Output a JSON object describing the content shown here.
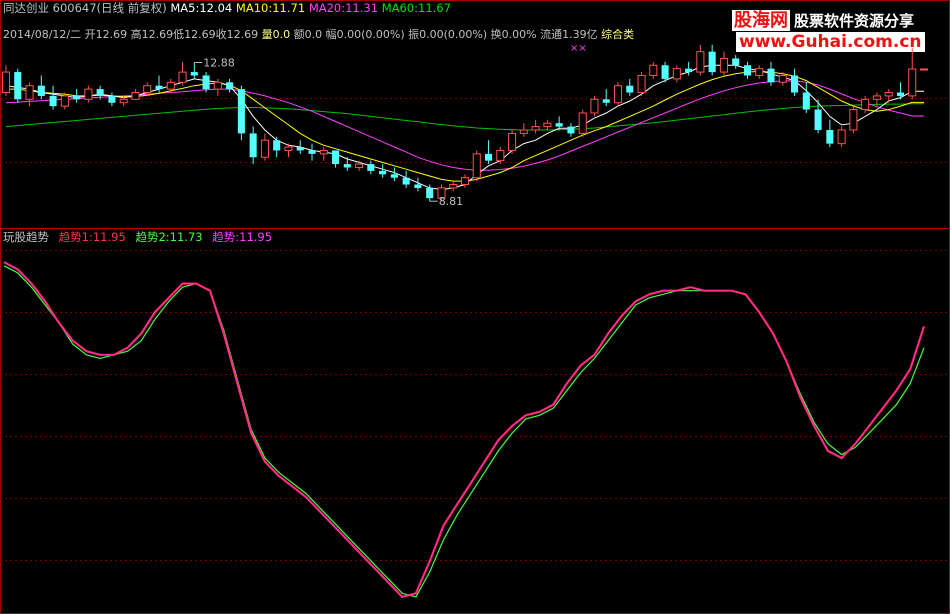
{
  "header": {
    "app": "同达创业",
    "code": "600647(日线 前复权)",
    "ma5_label": "MA5:",
    "ma5_value": "12.04",
    "ma10_label": "MA10:",
    "ma10_value": "11.71",
    "ma20_label": "MA20:",
    "ma20_value": "11.31",
    "ma60_label": "MA60:",
    "ma60_value": "11.67"
  },
  "quote": {
    "date": "2014/08/12/二",
    "open_label": "开",
    "open": "12.69",
    "high_label": "高",
    "high": "12.69",
    "low_label": "低",
    "low": "12.69",
    "close_label": "收",
    "close": "12.69",
    "vol_label": "量",
    "vol": "0.0",
    "amount_label": "额",
    "amount": "0.0",
    "range_label": "幅",
    "range": "0.00(0.00%)",
    "amp_label": "振",
    "amp": "0.00(0.00%)",
    "turnover_label": "换",
    "turnover": "0.00%",
    "float_label": "流通",
    "float": "1.39亿",
    "sector": "综合类",
    "marker": "××"
  },
  "indicator": {
    "name": "玩股趋势",
    "s1_label": "趋势1:",
    "s1_value": "11.95",
    "s2_label": "趋势2:",
    "s2_value": "11.73",
    "s3_label": "趋势:",
    "s3_value": "11.95"
  },
  "watermark": {
    "logo": "股海网",
    "tagline": "股票软件资源分享",
    "url": "www.Guhai.com.cn"
  },
  "colors": {
    "up": "#ff5050",
    "down": "#54ffff",
    "ma5": "#ffffff",
    "ma10": "#ffff00",
    "ma20": "#ff40ff",
    "ma60": "#00c000",
    "trend1": "#ff2050",
    "trend2": "#40ff40",
    "trend": "#ff40ff"
  },
  "chart_data": [
    {
      "type": "candlestick",
      "title": "600647",
      "ylim": [
        8.2,
        13.6
      ],
      "annotations": [
        {
          "label": "12.88",
          "value": 12.88
        },
        {
          "label": "8.81",
          "value": 8.81
        }
      ],
      "candles": [
        {
          "o": 12.0,
          "h": 12.8,
          "l": 11.9,
          "c": 12.6
        },
        {
          "o": 12.6,
          "h": 12.7,
          "l": 11.7,
          "c": 11.8
        },
        {
          "o": 11.8,
          "h": 12.3,
          "l": 11.6,
          "c": 12.2
        },
        {
          "o": 12.2,
          "h": 12.5,
          "l": 11.8,
          "c": 11.9
        },
        {
          "o": 11.9,
          "h": 12.2,
          "l": 11.5,
          "c": 11.6
        },
        {
          "o": 11.6,
          "h": 12.0,
          "l": 11.5,
          "c": 11.9
        },
        {
          "o": 11.9,
          "h": 12.1,
          "l": 11.7,
          "c": 11.8
        },
        {
          "o": 11.8,
          "h": 12.2,
          "l": 11.7,
          "c": 12.1
        },
        {
          "o": 12.1,
          "h": 12.2,
          "l": 11.8,
          "c": 11.9
        },
        {
          "o": 11.9,
          "h": 12.0,
          "l": 11.6,
          "c": 11.7
        },
        {
          "o": 11.7,
          "h": 11.9,
          "l": 11.6,
          "c": 11.8
        },
        {
          "o": 11.8,
          "h": 12.1,
          "l": 11.8,
          "c": 12.0
        },
        {
          "o": 12.0,
          "h": 12.3,
          "l": 11.9,
          "c": 12.2
        },
        {
          "o": 12.2,
          "h": 12.5,
          "l": 12.0,
          "c": 12.1
        },
        {
          "o": 12.1,
          "h": 12.4,
          "l": 12.0,
          "c": 12.3
        },
        {
          "o": 12.3,
          "h": 12.9,
          "l": 12.2,
          "c": 12.6
        },
        {
          "o": 12.6,
          "h": 12.88,
          "l": 12.4,
          "c": 12.5
        },
        {
          "o": 12.5,
          "h": 12.6,
          "l": 12.0,
          "c": 12.1
        },
        {
          "o": 12.1,
          "h": 12.4,
          "l": 11.9,
          "c": 12.3
        },
        {
          "o": 12.3,
          "h": 12.4,
          "l": 12.0,
          "c": 12.1
        },
        {
          "o": 12.1,
          "h": 12.2,
          "l": 10.6,
          "c": 10.8
        },
        {
          "o": 10.8,
          "h": 11.0,
          "l": 9.9,
          "c": 10.1
        },
        {
          "o": 10.1,
          "h": 10.8,
          "l": 10.0,
          "c": 10.6
        },
        {
          "o": 10.6,
          "h": 10.7,
          "l": 10.1,
          "c": 10.3
        },
        {
          "o": 10.3,
          "h": 10.5,
          "l": 10.1,
          "c": 10.4
        },
        {
          "o": 10.4,
          "h": 10.6,
          "l": 10.2,
          "c": 10.3
        },
        {
          "o": 10.3,
          "h": 10.5,
          "l": 10.0,
          "c": 10.2
        },
        {
          "o": 10.2,
          "h": 10.4,
          "l": 10.0,
          "c": 10.3
        },
        {
          "o": 10.3,
          "h": 10.3,
          "l": 9.8,
          "c": 9.9
        },
        {
          "o": 9.9,
          "h": 10.1,
          "l": 9.7,
          "c": 9.8
        },
        {
          "o": 9.8,
          "h": 10.0,
          "l": 9.7,
          "c": 9.9
        },
        {
          "o": 9.9,
          "h": 10.0,
          "l": 9.6,
          "c": 9.7
        },
        {
          "o": 9.7,
          "h": 9.9,
          "l": 9.5,
          "c": 9.6
        },
        {
          "o": 9.6,
          "h": 9.8,
          "l": 9.4,
          "c": 9.5
        },
        {
          "o": 9.5,
          "h": 9.7,
          "l": 9.2,
          "c": 9.3
        },
        {
          "o": 9.3,
          "h": 9.5,
          "l": 9.1,
          "c": 9.2
        },
        {
          "o": 9.2,
          "h": 9.3,
          "l": 8.81,
          "c": 8.9
        },
        {
          "o": 8.9,
          "h": 9.3,
          "l": 8.85,
          "c": 9.2
        },
        {
          "o": 9.2,
          "h": 9.4,
          "l": 9.1,
          "c": 9.3
        },
        {
          "o": 9.3,
          "h": 9.6,
          "l": 9.2,
          "c": 9.5
        },
        {
          "o": 9.5,
          "h": 10.3,
          "l": 9.4,
          "c": 10.2
        },
        {
          "o": 10.2,
          "h": 10.6,
          "l": 9.9,
          "c": 10.0
        },
        {
          "o": 10.0,
          "h": 10.4,
          "l": 9.9,
          "c": 10.3
        },
        {
          "o": 10.3,
          "h": 10.9,
          "l": 10.2,
          "c": 10.8
        },
        {
          "o": 10.8,
          "h": 11.1,
          "l": 10.7,
          "c": 10.9
        },
        {
          "o": 10.9,
          "h": 11.2,
          "l": 10.8,
          "c": 11.0
        },
        {
          "o": 11.0,
          "h": 11.2,
          "l": 10.9,
          "c": 11.1
        },
        {
          "o": 11.1,
          "h": 11.3,
          "l": 10.9,
          "c": 11.0
        },
        {
          "o": 11.0,
          "h": 11.1,
          "l": 10.7,
          "c": 10.8
        },
        {
          "o": 10.8,
          "h": 11.5,
          "l": 10.7,
          "c": 11.4
        },
        {
          "o": 11.4,
          "h": 11.9,
          "l": 11.3,
          "c": 11.8
        },
        {
          "o": 11.8,
          "h": 12.1,
          "l": 11.6,
          "c": 11.7
        },
        {
          "o": 11.7,
          "h": 12.3,
          "l": 11.6,
          "c": 12.2
        },
        {
          "o": 12.2,
          "h": 12.4,
          "l": 11.9,
          "c": 12.0
        },
        {
          "o": 12.0,
          "h": 12.6,
          "l": 11.9,
          "c": 12.5
        },
        {
          "o": 12.5,
          "h": 12.9,
          "l": 12.4,
          "c": 12.8
        },
        {
          "o": 12.8,
          "h": 12.9,
          "l": 12.3,
          "c": 12.4
        },
        {
          "o": 12.4,
          "h": 12.8,
          "l": 12.3,
          "c": 12.7
        },
        {
          "o": 12.7,
          "h": 12.9,
          "l": 12.5,
          "c": 12.6
        },
        {
          "o": 12.6,
          "h": 13.4,
          "l": 12.5,
          "c": 13.2
        },
        {
          "o": 13.2,
          "h": 13.4,
          "l": 12.5,
          "c": 12.6
        },
        {
          "o": 12.6,
          "h": 13.2,
          "l": 12.5,
          "c": 13.0
        },
        {
          "o": 13.0,
          "h": 13.1,
          "l": 12.7,
          "c": 12.8
        },
        {
          "o": 12.8,
          "h": 12.9,
          "l": 12.4,
          "c": 12.5
        },
        {
          "o": 12.5,
          "h": 12.8,
          "l": 12.4,
          "c": 12.7
        },
        {
          "o": 12.7,
          "h": 12.9,
          "l": 12.2,
          "c": 12.3
        },
        {
          "o": 12.3,
          "h": 12.6,
          "l": 12.2,
          "c": 12.5
        },
        {
          "o": 12.5,
          "h": 12.7,
          "l": 11.9,
          "c": 12.0
        },
        {
          "o": 12.0,
          "h": 12.3,
          "l": 11.4,
          "c": 11.5
        },
        {
          "o": 11.5,
          "h": 11.8,
          "l": 10.8,
          "c": 10.9
        },
        {
          "o": 10.9,
          "h": 11.2,
          "l": 10.4,
          "c": 10.5
        },
        {
          "o": 10.5,
          "h": 11.0,
          "l": 10.4,
          "c": 10.9
        },
        {
          "o": 10.9,
          "h": 11.6,
          "l": 10.8,
          "c": 11.5
        },
        {
          "o": 11.5,
          "h": 11.9,
          "l": 11.4,
          "c": 11.8
        },
        {
          "o": 11.8,
          "h": 12.0,
          "l": 11.6,
          "c": 11.9
        },
        {
          "o": 11.9,
          "h": 12.1,
          "l": 11.7,
          "c": 12.0
        },
        {
          "o": 12.0,
          "h": 12.3,
          "l": 11.8,
          "c": 11.9
        },
        {
          "o": 11.9,
          "h": 13.3,
          "l": 11.8,
          "c": 12.69
        },
        {
          "o": 12.69,
          "h": 12.69,
          "l": 12.69,
          "c": 12.69
        }
      ],
      "ma5": [
        12.2,
        12.15,
        12.1,
        12.0,
        11.95,
        11.9,
        11.85,
        11.9,
        11.95,
        11.9,
        11.85,
        11.9,
        12.0,
        12.1,
        12.2,
        12.3,
        12.4,
        12.35,
        12.3,
        12.2,
        11.8,
        11.3,
        10.9,
        10.6,
        10.45,
        10.4,
        10.3,
        10.25,
        10.2,
        10.05,
        9.95,
        9.85,
        9.75,
        9.65,
        9.5,
        9.35,
        9.2,
        9.15,
        9.2,
        9.3,
        9.6,
        9.85,
        10.0,
        10.3,
        10.5,
        10.6,
        10.8,
        10.95,
        10.95,
        11.05,
        11.25,
        11.4,
        11.6,
        11.75,
        11.95,
        12.2,
        12.35,
        12.5,
        12.6,
        12.75,
        12.8,
        12.8,
        12.8,
        12.7,
        12.65,
        12.55,
        12.45,
        12.35,
        12.05,
        11.7,
        11.3,
        11.05,
        11.1,
        11.3,
        11.5,
        11.75,
        11.85,
        12.04,
        12.04
      ],
      "ma10": [
        12.1,
        12.1,
        12.05,
        12.0,
        11.98,
        11.95,
        11.9,
        11.9,
        11.92,
        11.9,
        11.88,
        11.88,
        11.92,
        11.98,
        12.05,
        12.12,
        12.2,
        12.25,
        12.28,
        12.22,
        12.05,
        11.8,
        11.55,
        11.3,
        11.05,
        10.8,
        10.6,
        10.45,
        10.35,
        10.25,
        10.15,
        10.05,
        9.95,
        9.85,
        9.75,
        9.65,
        9.55,
        9.45,
        9.4,
        9.4,
        9.45,
        9.55,
        9.65,
        9.8,
        10.0,
        10.15,
        10.3,
        10.45,
        10.6,
        10.75,
        10.88,
        11.0,
        11.15,
        11.3,
        11.45,
        11.6,
        11.78,
        11.95,
        12.1,
        12.25,
        12.38,
        12.48,
        12.55,
        12.6,
        12.62,
        12.6,
        12.55,
        12.48,
        12.35,
        12.15,
        11.95,
        11.75,
        11.6,
        11.5,
        11.45,
        11.5,
        11.6,
        11.71,
        11.71
      ],
      "ma20": [
        11.7,
        11.72,
        11.74,
        11.76,
        11.78,
        11.8,
        11.82,
        11.84,
        11.86,
        11.88,
        11.9,
        11.92,
        11.95,
        11.98,
        12.0,
        12.02,
        12.05,
        12.08,
        12.1,
        12.1,
        12.05,
        11.98,
        11.9,
        11.8,
        11.7,
        11.58,
        11.45,
        11.3,
        11.15,
        11.0,
        10.85,
        10.7,
        10.55,
        10.4,
        10.25,
        10.1,
        9.98,
        9.88,
        9.8,
        9.75,
        9.72,
        9.72,
        9.74,
        9.78,
        9.84,
        9.92,
        10.02,
        10.14,
        10.28,
        10.42,
        10.56,
        10.7,
        10.84,
        10.98,
        11.12,
        11.26,
        11.4,
        11.54,
        11.68,
        11.82,
        11.94,
        12.05,
        12.14,
        12.22,
        12.28,
        12.32,
        12.34,
        12.34,
        12.3,
        12.22,
        12.1,
        11.96,
        11.82,
        11.7,
        11.58,
        11.48,
        11.4,
        11.31,
        11.31
      ],
      "ma60": [
        11.0,
        11.03,
        11.06,
        11.09,
        11.12,
        11.15,
        11.18,
        11.21,
        11.24,
        11.27,
        11.3,
        11.33,
        11.36,
        11.39,
        11.42,
        11.45,
        11.48,
        11.51,
        11.53,
        11.55,
        11.56,
        11.56,
        11.55,
        11.54,
        11.52,
        11.5,
        11.47,
        11.44,
        11.41,
        11.38,
        11.34,
        11.3,
        11.26,
        11.22,
        11.18,
        11.14,
        11.1,
        11.06,
        11.02,
        10.99,
        10.96,
        10.94,
        10.92,
        10.91,
        10.9,
        10.9,
        10.9,
        10.91,
        10.92,
        10.94,
        10.96,
        10.99,
        11.02,
        11.05,
        11.08,
        11.11,
        11.15,
        11.19,
        11.23,
        11.27,
        11.31,
        11.35,
        11.39,
        11.43,
        11.47,
        11.5,
        11.53,
        11.56,
        11.58,
        11.6,
        11.61,
        11.62,
        11.63,
        11.64,
        11.65,
        11.66,
        11.66,
        11.67,
        11.67
      ]
    },
    {
      "type": "line",
      "title": "玩股趋势",
      "ylim": [
        0,
        100
      ],
      "series": [
        {
          "name": "趋势1",
          "values": [
            96,
            94,
            90,
            85,
            79,
            74,
            71,
            70,
            70,
            72,
            76,
            82,
            86,
            90,
            90,
            88,
            76,
            62,
            48,
            40,
            36,
            33,
            30,
            26,
            22,
            18,
            14,
            10,
            6,
            2,
            3,
            12,
            22,
            28,
            34,
            40,
            46,
            50,
            53,
            54,
            56,
            62,
            67,
            70,
            76,
            81,
            85,
            87,
            88,
            88,
            89,
            88,
            88,
            88,
            87,
            82,
            76,
            68,
            58,
            50,
            43,
            41,
            45,
            50,
            55,
            60,
            66,
            78
          ]
        },
        {
          "name": "趋势2",
          "values": [
            95,
            93,
            89,
            84,
            79,
            73,
            70,
            69,
            70,
            71,
            74,
            80,
            85,
            89,
            90,
            88,
            77,
            63,
            49,
            41,
            37,
            34,
            31,
            27,
            23,
            19,
            15,
            11,
            7,
            3,
            2,
            9,
            18,
            25,
            31,
            37,
            43,
            48,
            52,
            53,
            55,
            60,
            65,
            69,
            74,
            79,
            84,
            86,
            87,
            88,
            88,
            88,
            88,
            88,
            87,
            82,
            76,
            68,
            59,
            51,
            45,
            42,
            44,
            48,
            52,
            56,
            62,
            72
          ]
        },
        {
          "name": "趋势",
          "values": [
            96,
            94,
            90,
            85,
            79,
            74,
            71,
            70,
            70,
            72,
            76,
            82,
            86,
            90,
            90,
            88,
            76,
            62,
            48,
            40,
            36,
            33,
            30,
            26,
            22,
            18,
            14,
            10,
            6,
            2,
            3,
            12,
            22,
            28,
            34,
            40,
            46,
            50,
            53,
            54,
            56,
            62,
            67,
            70,
            76,
            81,
            85,
            87,
            88,
            88,
            89,
            88,
            88,
            88,
            87,
            82,
            76,
            68,
            58,
            50,
            43,
            41,
            45,
            50,
            55,
            60,
            66,
            78
          ]
        }
      ]
    }
  ]
}
